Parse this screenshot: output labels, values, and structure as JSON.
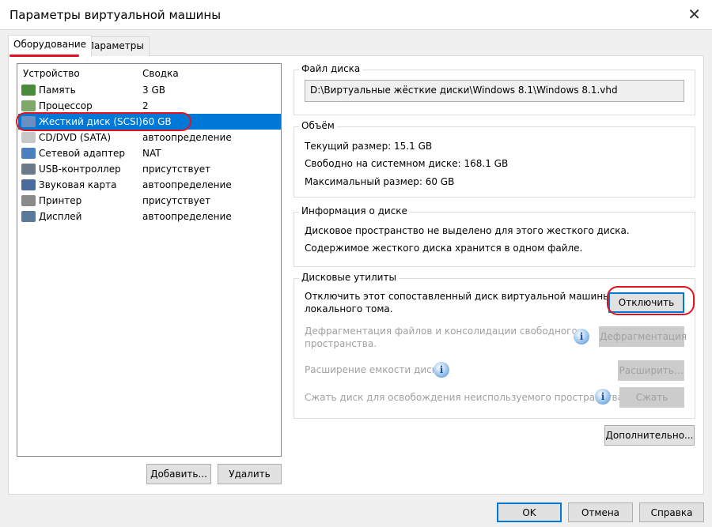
{
  "window": {
    "title": "Параметры виртуальной машины",
    "close_icon": "close-icon"
  },
  "tabs": [
    {
      "label": "Оборудование",
      "active": true
    },
    {
      "label": "Параметры",
      "active": false
    }
  ],
  "devices": {
    "headers": [
      "Устройство",
      "Сводка"
    ],
    "rows": [
      {
        "name": "Память",
        "summary": "3 GB",
        "icon": "memory-icon",
        "color": "#4a8a3a"
      },
      {
        "name": "Процессор",
        "summary": "2",
        "icon": "processor-icon",
        "color": "#7fa86a"
      },
      {
        "name": "Жесткий диск (SCSI)",
        "summary": "60 GB",
        "icon": "hard-disk-icon",
        "color": "#6a8fc0",
        "selected": true
      },
      {
        "name": "CD/DVD (SATA)",
        "summary": "автоопределение",
        "icon": "cd-dvd-icon",
        "color": "#c8c8c8"
      },
      {
        "name": "Сетевой адаптер",
        "summary": "NAT",
        "icon": "network-adapter-icon",
        "color": "#4a7fc0"
      },
      {
        "name": "USB-контроллер",
        "summary": "присутствует",
        "icon": "usb-icon",
        "color": "#6a7a8a"
      },
      {
        "name": "Звуковая карта",
        "summary": "автоопределение",
        "icon": "sound-card-icon",
        "color": "#4a6aa0"
      },
      {
        "name": "Принтер",
        "summary": "присутствует",
        "icon": "printer-icon",
        "color": "#8a8a8a"
      },
      {
        "name": "Дисплей",
        "summary": "автоопределение",
        "icon": "display-icon",
        "color": "#5a7a9a"
      }
    ],
    "add_label": "Добавить...",
    "remove_label": "Удалить"
  },
  "disk_file": {
    "title": "Файл диска",
    "path": "D:\\Виртуальные жёсткие диски\\Windows 8.1\\Windows 8.1.vhd"
  },
  "capacity": {
    "title": "Объём",
    "current": "Текущий размер: 15.1 GB",
    "free": "Свободно на системном диске: 168.1 GB",
    "max": "Максимальный размер: 60 GB"
  },
  "disk_info": {
    "title": "Информация о диске",
    "line1": "Дисковое пространство не выделено для этого жесткого диска.",
    "line2": "Содержимое жесткого диска хранится в одном файле."
  },
  "utilities": {
    "title": "Дисковые утилиты",
    "unmap_text1": "Отключить этот сопоставленный диск виртуальной машины от",
    "unmap_text2": "локального тома.",
    "unmap_label": "Отключить",
    "defrag_text1": "Дефрагментация файлов и консолидации свободного",
    "defrag_text2": "пространства.",
    "defrag_label": "Дефрагментация",
    "expand_text": "Расширение емкости диска.",
    "expand_label": "Расширить...",
    "compact_text": "Сжать диск для освобождения неиспользуемого пространства.",
    "compact_label": "Сжать",
    "info_glyph": "i"
  },
  "advanced_label": "Дополнительно...",
  "footer": {
    "ok": "OK",
    "cancel": "Отмена",
    "help": "Справка"
  },
  "annotation_color": "#e0141e"
}
